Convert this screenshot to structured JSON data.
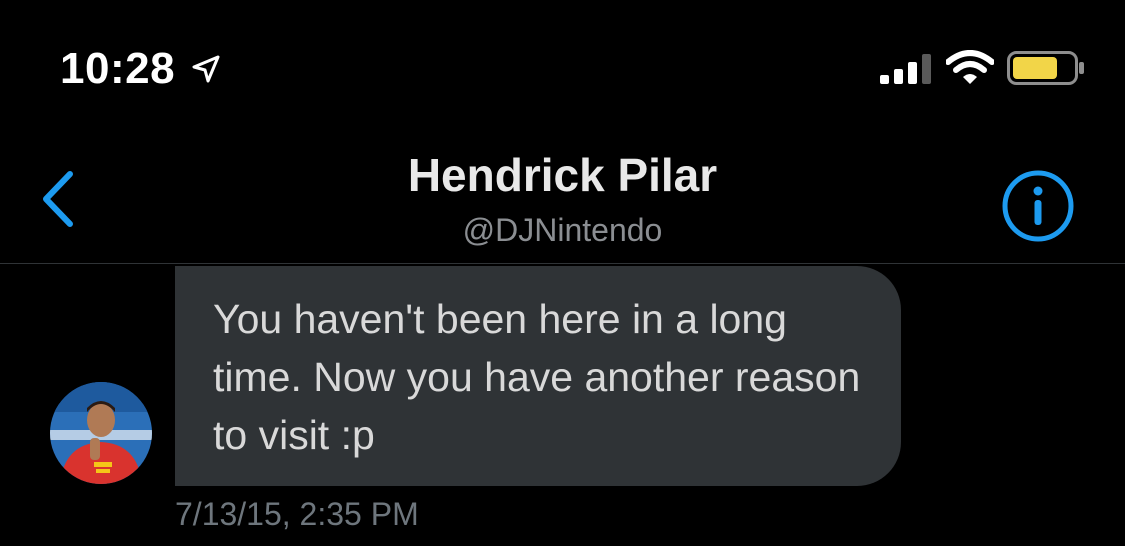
{
  "status_bar": {
    "time": "10:28",
    "icons": [
      "location-arrow-icon",
      "cellular-signal-icon",
      "wifi-icon",
      "battery-icon"
    ],
    "battery_color": "#f2d548"
  },
  "header": {
    "back_icon": "chevron-left-icon",
    "title": "Hendrick Pilar",
    "handle": "@DJNintendo",
    "info_icon": "info-icon",
    "accent_color": "#1d9bf0"
  },
  "conversation": {
    "messages": [
      {
        "sender": "other",
        "text": "You haven't been here in a long time. Now you have another reason to visit :p",
        "timestamp": "7/13/15, 2:35 PM"
      }
    ]
  }
}
